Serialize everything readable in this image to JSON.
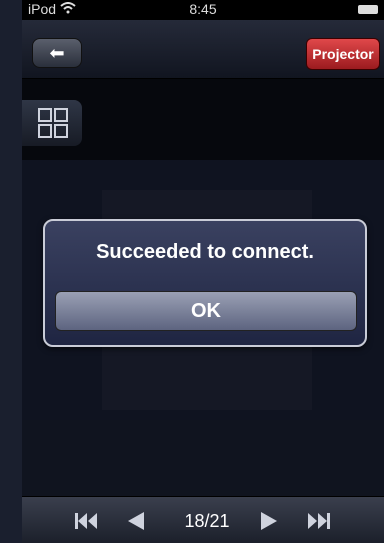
{
  "status_bar": {
    "carrier": "iPod",
    "time": "8:45"
  },
  "nav": {
    "projector_label": "Projector"
  },
  "alert": {
    "title": "Succeeded to connect.",
    "ok_label": "OK"
  },
  "toolbar": {
    "page": "18/21"
  },
  "icons": {
    "wifi": "wifi-icon",
    "battery": "battery-icon",
    "back": "arrow-left-icon",
    "grid": "grid-icon",
    "first": "skip-to-start-icon",
    "prev": "triangle-left-icon",
    "next": "triangle-right-icon",
    "last": "skip-to-end-icon"
  },
  "colors": {
    "projector_button": "#c42a2e",
    "alert_bg": "#2a3150"
  }
}
